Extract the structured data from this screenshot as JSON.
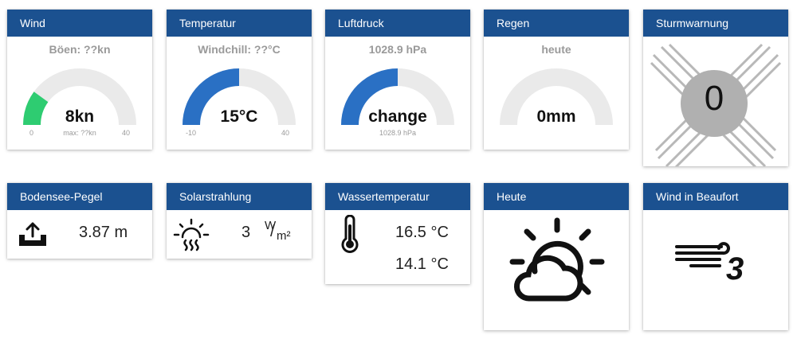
{
  "colors": {
    "header_bg": "#1b5190",
    "gauge_track": "#eaeaea",
    "gauge_green": "#2ecc71",
    "gauge_blue": "#2a70c4",
    "storm_circle": "#b0b0b0"
  },
  "wind": {
    "title": "Wind",
    "gusts_label": "Böen: ??kn",
    "value": "8kn",
    "max_label": "max: ??kn",
    "min_tick": "0",
    "max_tick": "40",
    "level": 8,
    "range": [
      0,
      40
    ]
  },
  "temperature": {
    "title": "Temperatur",
    "windchill_label": "Windchill: ??°C",
    "value": "15°C",
    "min_tick": "-10",
    "max_tick": "40",
    "level": 15,
    "range": [
      -10,
      40
    ]
  },
  "pressure": {
    "title": "Luftdruck",
    "pressure_label": "1028.9 hPa",
    "value": "change",
    "secondary": "1028.9 hPa",
    "fill_fraction": 0.5
  },
  "rain": {
    "title": "Regen",
    "period_label": "heute",
    "value": "0mm",
    "fill_fraction": 0
  },
  "storm": {
    "title": "Sturmwarnung",
    "value": "0"
  },
  "lake": {
    "title": "Bodensee-Pegel",
    "icon": "water-level-icon",
    "value": "3.87 m"
  },
  "solar": {
    "title": "Solarstrahlung",
    "icon": "sun-heat-icon",
    "value": "3",
    "unit_numerator": "W",
    "unit_denominator": "m²"
  },
  "water_temp": {
    "title": "Wassertemperatur",
    "icon": "thermometer-icon",
    "value1": "16.5 °C",
    "value2": "14.1 °C"
  },
  "today": {
    "title": "Heute",
    "icon": "partly-cloudy-icon"
  },
  "beaufort": {
    "title": "Wind in Beaufort",
    "icon": "wind-beaufort-3-icon",
    "value": "3"
  }
}
